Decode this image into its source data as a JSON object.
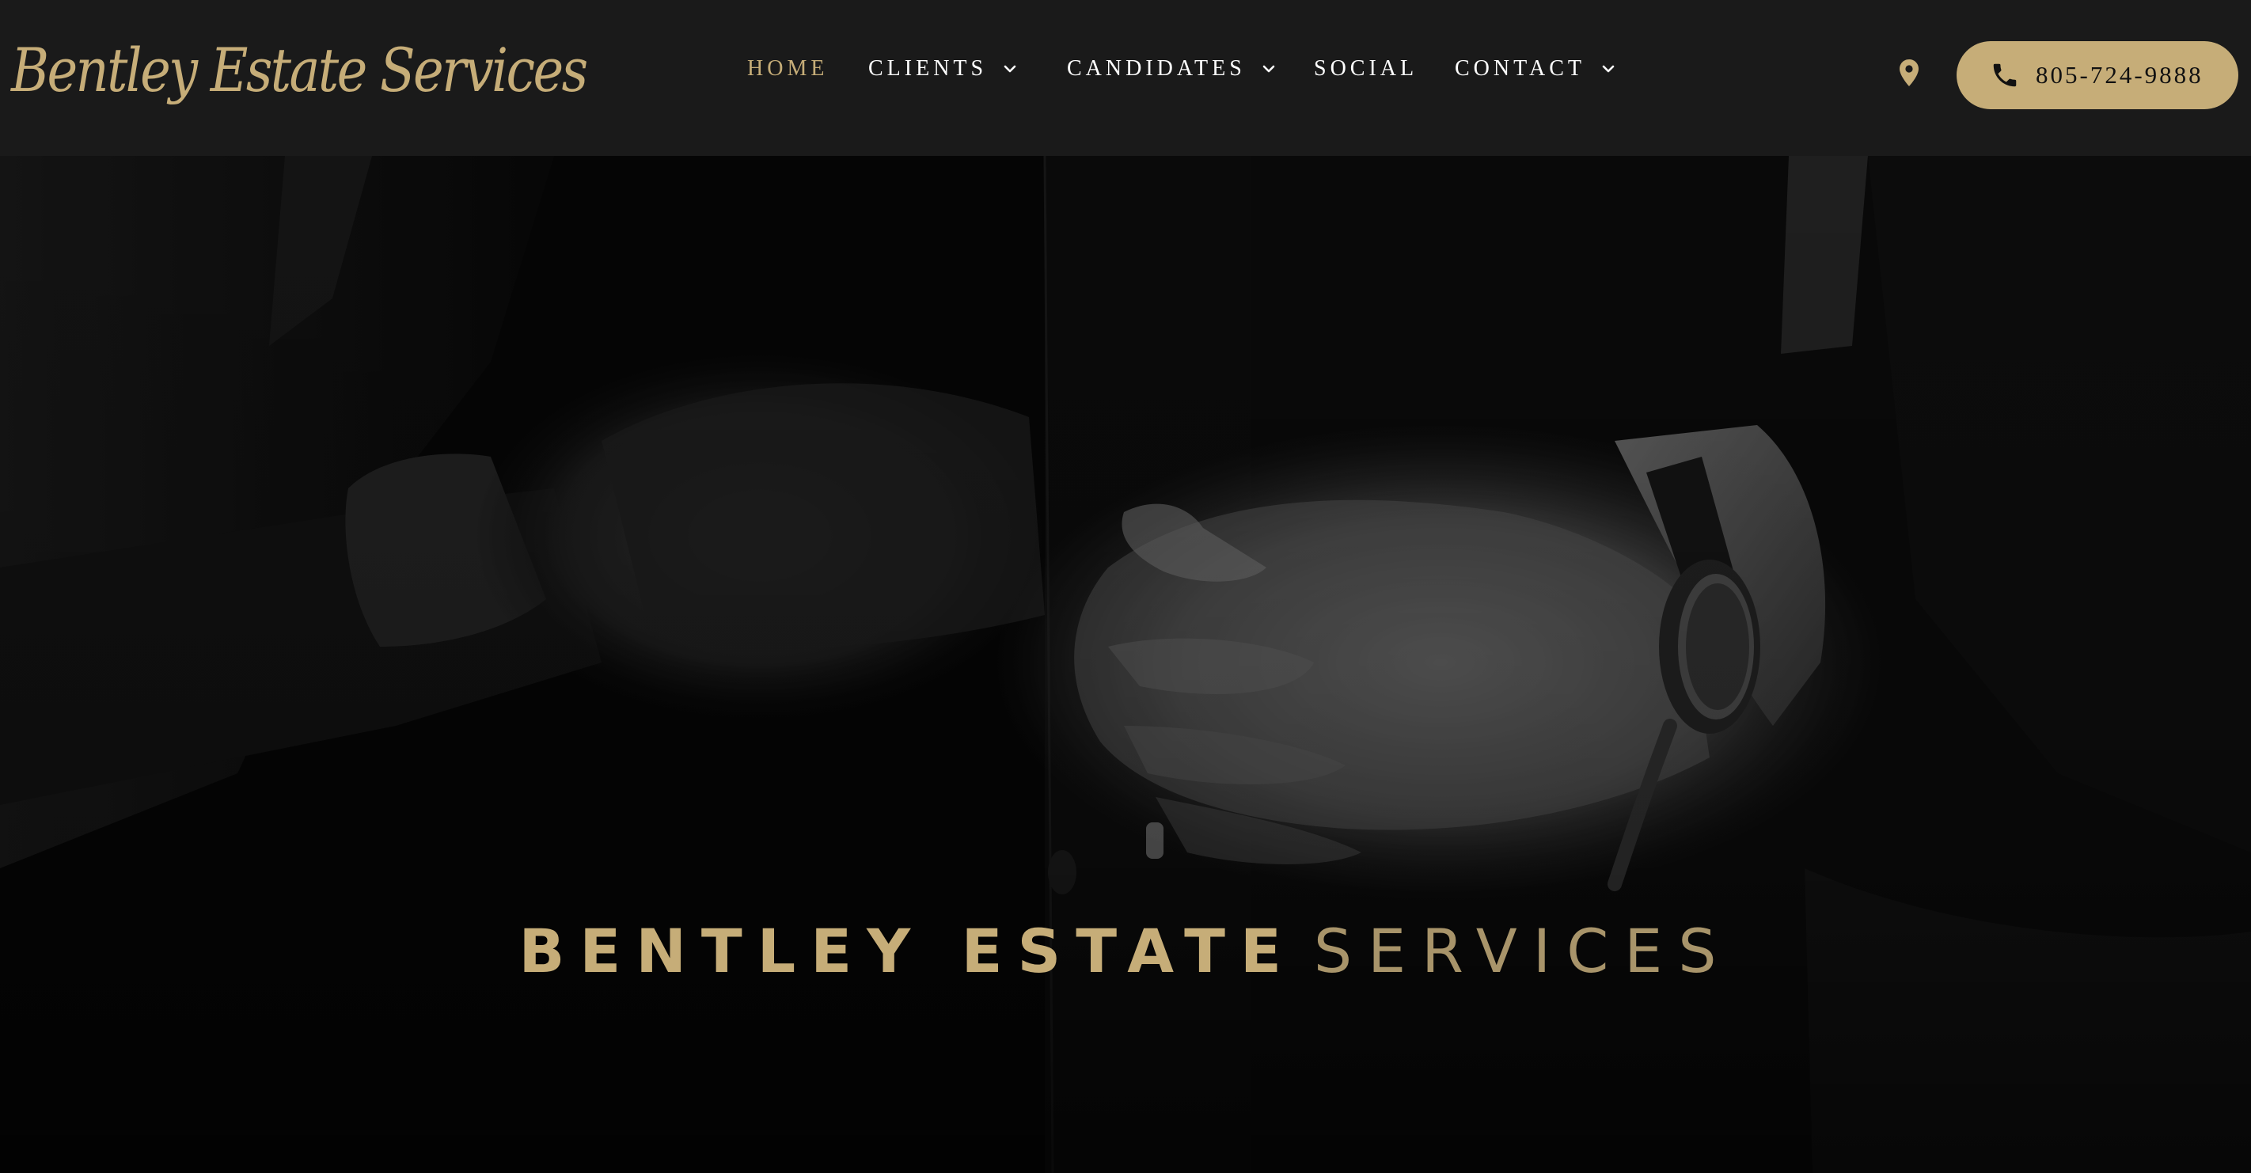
{
  "brand": {
    "logo_text": "Bentley Estate Services",
    "accent_color": "#c6ad78",
    "header_bg": "#1a1a1a"
  },
  "nav": {
    "items": [
      {
        "label": "HOME",
        "active": true,
        "has_dropdown": false
      },
      {
        "label": "CLIENTS",
        "active": false,
        "has_dropdown": true
      },
      {
        "label": "CANDIDATES",
        "active": false,
        "has_dropdown": true
      },
      {
        "label": "SOCIAL",
        "active": false,
        "has_dropdown": false
      },
      {
        "label": "CONTACT",
        "active": false,
        "has_dropdown": true
      }
    ],
    "dropdown_icon": "chevron-down-icon"
  },
  "header_actions": {
    "location_icon": "map-pin-icon",
    "phone_icon": "phone-icon",
    "phone_number": "805-724-9888"
  },
  "hero": {
    "title_bold": "BENTLEY ESTATE",
    "title_light": "SERVICES",
    "background": "black-and-white photo of hands adjusting a suit jacket button"
  }
}
